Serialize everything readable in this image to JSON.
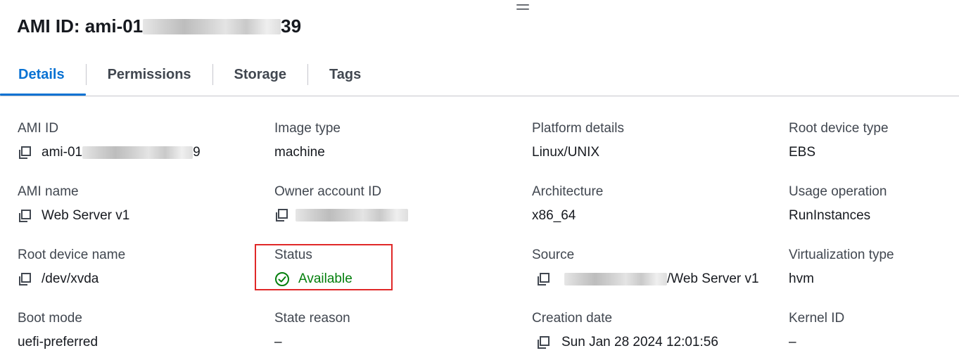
{
  "header": {
    "title_prefix": "AMI ID: ami-01",
    "title_suffix": "39"
  },
  "tabs": [
    {
      "label": "Details"
    },
    {
      "label": "Permissions"
    },
    {
      "label": "Storage"
    },
    {
      "label": "Tags"
    }
  ],
  "active_tab": "Details",
  "details": {
    "ami_id": {
      "label": "AMI ID",
      "value_prefix": "ami-01",
      "value_suffix": "9"
    },
    "image_type": {
      "label": "Image type",
      "value": "machine"
    },
    "platform_details": {
      "label": "Platform details",
      "value": "Linux/UNIX"
    },
    "root_device_type": {
      "label": "Root device type",
      "value": "EBS"
    },
    "ami_name": {
      "label": "AMI name",
      "value": "Web Server v1"
    },
    "owner_account_id": {
      "label": "Owner account ID"
    },
    "architecture": {
      "label": "Architecture",
      "value": "x86_64"
    },
    "usage_operation": {
      "label": "Usage operation",
      "value": "RunInstances"
    },
    "root_device_name": {
      "label": "Root device name",
      "value": "/dev/xvda"
    },
    "status": {
      "label": "Status",
      "value": "Available"
    },
    "source": {
      "label": "Source",
      "value_suffix": "/Web Server v1"
    },
    "virtualization_type": {
      "label": "Virtualization type",
      "value": "hvm"
    },
    "boot_mode": {
      "label": "Boot mode",
      "value": "uefi-preferred"
    },
    "state_reason": {
      "label": "State reason",
      "value": "–"
    },
    "creation_date": {
      "label": "Creation date",
      "value": "Sun Jan 28 2024 12:01:56"
    },
    "kernel_id": {
      "label": "Kernel ID",
      "value": "–"
    }
  },
  "icons": {
    "copy": "copy-icon",
    "status": "check-circle-icon"
  },
  "colors": {
    "accent": "#0972d3",
    "success": "#037f0c",
    "highlight": "#e02828"
  }
}
